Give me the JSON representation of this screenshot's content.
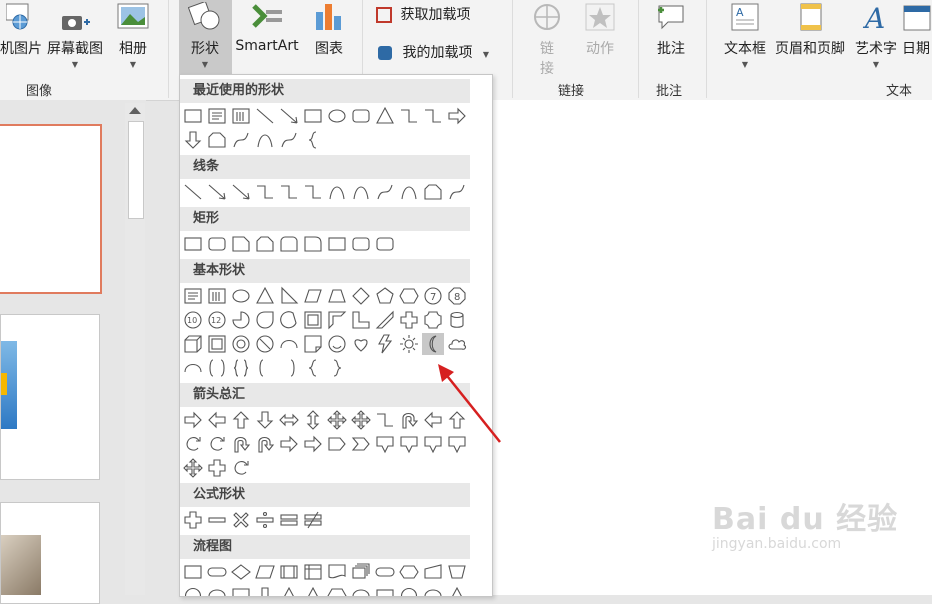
{
  "ribbon": {
    "images_group": {
      "photos_label": "机图片",
      "screenshot_label": "屏幕截图",
      "album_label": "相册",
      "group_label": "图像"
    },
    "illustrations": {
      "shapes_label": "形状",
      "smartart_label": "SmartArt",
      "chart_label": "图表"
    },
    "addins": {
      "get_label": "获取加载项",
      "my_label": "我的加载项"
    },
    "links": {
      "link_label": "链接",
      "link_split_1": "链",
      "link_split_2": "接",
      "action_label": "动作",
      "group_label": "链接"
    },
    "comments": {
      "comment_label": "批注",
      "group_label": "批注"
    },
    "text": {
      "textbox_label": "文本框",
      "header_footer_label": "页眉和页脚",
      "wordart_label": "艺术字",
      "date_label": "日期",
      "group_label": "文本"
    }
  },
  "shapes_menu": {
    "categories": [
      "最近使用的形状",
      "线条",
      "矩形",
      "基本形状",
      "箭头总汇",
      "公式形状",
      "流程图"
    ],
    "highlighted_shape": "moon"
  },
  "colors": {
    "accent_selected_thumb": "#e07b5e",
    "arrow": "#d62020"
  },
  "watermark": {
    "line1": "Bai du 经验",
    "line2": "jingyan.baidu.com"
  }
}
